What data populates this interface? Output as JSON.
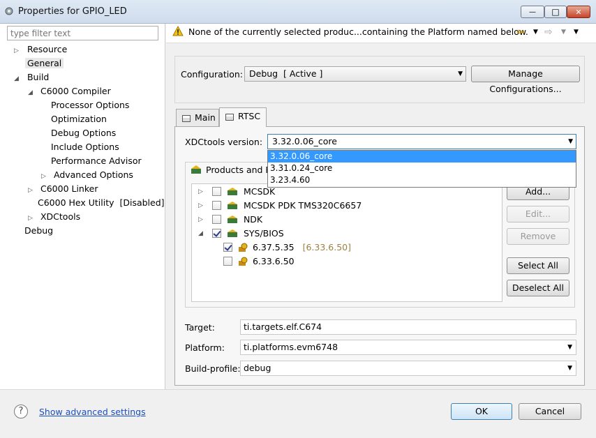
{
  "window": {
    "title": "Properties for GPIO_LED",
    "controls": {
      "minimize": "—",
      "maximize": "□",
      "close": "✕"
    }
  },
  "nav": {
    "filter_placeholder": "type filter text",
    "items": [
      {
        "label": "Resource",
        "indent": 0,
        "expander": "▷"
      },
      {
        "label": "General",
        "indent": 0,
        "expander": "",
        "selected": true
      },
      {
        "label": "Build",
        "indent": 0,
        "expander": "◢"
      },
      {
        "label": "C6000 Compiler",
        "indent": 1,
        "expander": "◢"
      },
      {
        "label": "Processor Options",
        "indent": 2,
        "expander": ""
      },
      {
        "label": "Optimization",
        "indent": 2,
        "expander": ""
      },
      {
        "label": "Debug Options",
        "indent": 2,
        "expander": ""
      },
      {
        "label": "Include Options",
        "indent": 2,
        "expander": ""
      },
      {
        "label": "Performance Advisor",
        "indent": 2,
        "expander": ""
      },
      {
        "label": "Advanced Options",
        "indent": 2,
        "expander": "▷"
      },
      {
        "label": "C6000 Linker",
        "indent": 1,
        "expander": "▷"
      },
      {
        "label": "C6000 Hex Utility  [Disabled]",
        "indent": 1,
        "expander": ""
      },
      {
        "label": "XDCtools",
        "indent": 1,
        "expander": "▷"
      },
      {
        "label": "Debug",
        "indent": 0,
        "expander": ""
      }
    ]
  },
  "warning": {
    "text": "None of the currently selected produc...containing the Platform named below."
  },
  "configuration": {
    "label": "Configuration:",
    "value": "Debug  [ Active ]",
    "manage_button": "Manage Configurations..."
  },
  "tabs": [
    {
      "label": "Main",
      "active": false
    },
    {
      "label": "RTSC",
      "active": true
    }
  ],
  "rtsc": {
    "xdc_label": "XDCtools version:",
    "xdc_value": "3.32.0.06_core",
    "xdc_options": [
      "3.32.0.06_core",
      "3.31.0.24_core",
      "3.23.4.60"
    ],
    "products_group_label": "Products and R",
    "products": [
      {
        "name": "MCSDK",
        "level": 0,
        "expander": "▷",
        "checked": false,
        "version_hint": ""
      },
      {
        "name": "MCSDK PDK TMS320C6657",
        "level": 0,
        "expander": "▷",
        "checked": false,
        "version_hint": ""
      },
      {
        "name": "NDK",
        "level": 0,
        "expander": "▷",
        "checked": false,
        "version_hint": ""
      },
      {
        "name": "SYS/BIOS",
        "level": 0,
        "expander": "◢",
        "checked": true,
        "version_hint": ""
      },
      {
        "name": "6.37.5.35",
        "level": 1,
        "expander": "",
        "checked": true,
        "version_hint": "[6.33.6.50]"
      },
      {
        "name": "6.33.6.50",
        "level": 1,
        "expander": "",
        "checked": false,
        "version_hint": ""
      }
    ],
    "buttons": {
      "add": "Add...",
      "edit": "Edit...",
      "remove": "Remove",
      "select_all": "Select All",
      "deselect_all": "Deselect All"
    },
    "target_label": "Target:",
    "target_value": "ti.targets.elf.C674",
    "platform_label": "Platform:",
    "platform_value": "ti.platforms.evm6748",
    "build_profile_label": "Build-profile:",
    "build_profile_value": "debug"
  },
  "footer": {
    "help_glyph": "?",
    "advanced_link": "Show advanced settings",
    "ok": "OK",
    "cancel": "Cancel"
  },
  "colors": {
    "accent": "#3399ff",
    "link": "#1a4fbf",
    "warning": "#e6b800",
    "version_hint": "#a08040"
  }
}
